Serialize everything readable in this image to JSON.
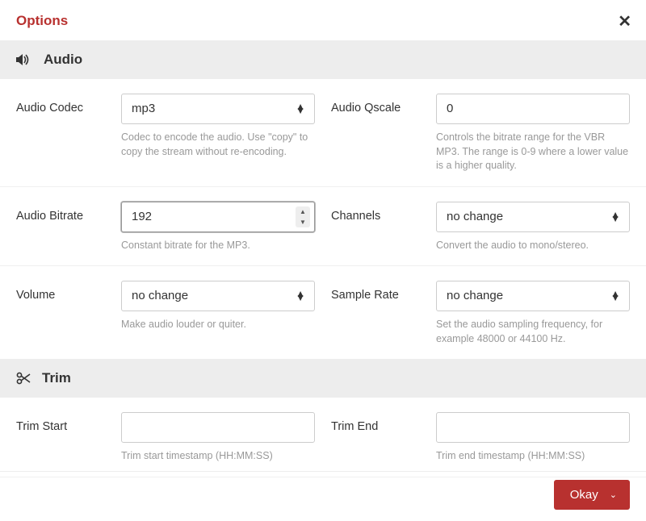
{
  "title": "Options",
  "sections": {
    "audio": {
      "title": "Audio",
      "codec": {
        "label": "Audio Codec",
        "value": "mp3",
        "hint": "Codec to encode the audio. Use \"copy\" to copy the stream without re-encoding."
      },
      "qscale": {
        "label": "Audio Qscale",
        "value": "0",
        "hint": "Controls the bitrate range for the VBR MP3. The range is 0-9 where a lower value is a higher quality."
      },
      "bitrate": {
        "label": "Audio Bitrate",
        "value": "192",
        "hint": "Constant bitrate for the MP3."
      },
      "channels": {
        "label": "Channels",
        "value": "no change",
        "hint": "Convert the audio to mono/stereo."
      },
      "volume": {
        "label": "Volume",
        "value": "no change",
        "hint": "Make audio louder or quiter."
      },
      "sample_rate": {
        "label": "Sample Rate",
        "value": "no change",
        "hint": "Set the audio sampling frequency, for example 48000 or 44100 Hz."
      }
    },
    "trim": {
      "title": "Trim",
      "start": {
        "label": "Trim Start",
        "value": "",
        "hint": "Trim start timestamp (HH:MM:SS)"
      },
      "end": {
        "label": "Trim End",
        "value": "",
        "hint": "Trim end timestamp (HH:MM:SS)"
      }
    }
  },
  "footer": {
    "okay_label": "Okay"
  }
}
